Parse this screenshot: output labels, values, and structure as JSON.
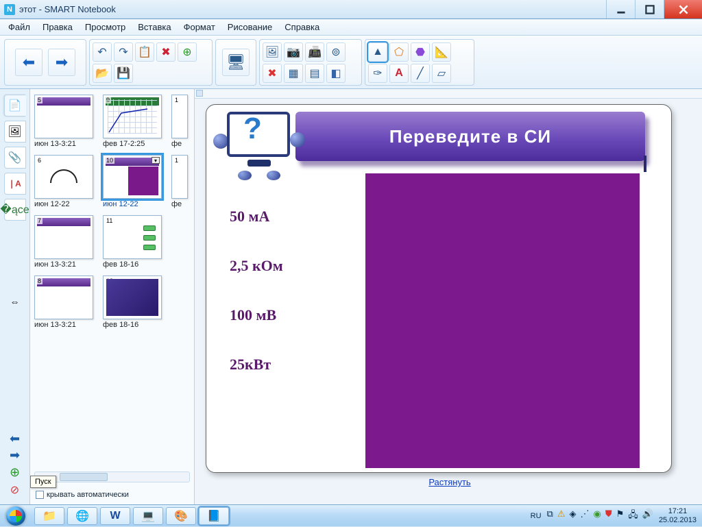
{
  "window": {
    "title": "этот - SMART Notebook"
  },
  "menu": {
    "file": "Файл",
    "edit": "Правка",
    "view": "Просмотр",
    "insert": "Вставка",
    "format": "Формат",
    "draw": "Рисование",
    "help": "Справка"
  },
  "thumbs": [
    {
      "n": "5",
      "cap": "июн 13-3:21"
    },
    {
      "n": "9",
      "cap": "фев 17-2:25"
    },
    {
      "n": "1",
      "cap": "фе"
    },
    {
      "n": "6",
      "cap": "июн 12-22"
    },
    {
      "n": "10",
      "cap": "июн 12-22",
      "selected": true
    },
    {
      "n": "1",
      "cap": "фе"
    },
    {
      "n": "7",
      "cap": "июн 13-3:21"
    },
    {
      "n": "11",
      "cap": "фев 18-16"
    },
    {
      "n": "8",
      "cap": "июн 13-3:21"
    },
    {
      "n": "12",
      "cap": "фев 18-16"
    }
  ],
  "sidebar": {
    "autohide_label": "крывать автоматически",
    "start_tip": "Пуск"
  },
  "slide": {
    "header": "Переведите   в  СИ",
    "v1": "50 мА",
    "v2": "2,5 кОм",
    "v3": "100 мВ",
    "v4": "25кВт",
    "stretch": "Растянуть"
  },
  "taskbar": {
    "lang": "RU",
    "time": "17:21",
    "date": "25.02.2013"
  }
}
